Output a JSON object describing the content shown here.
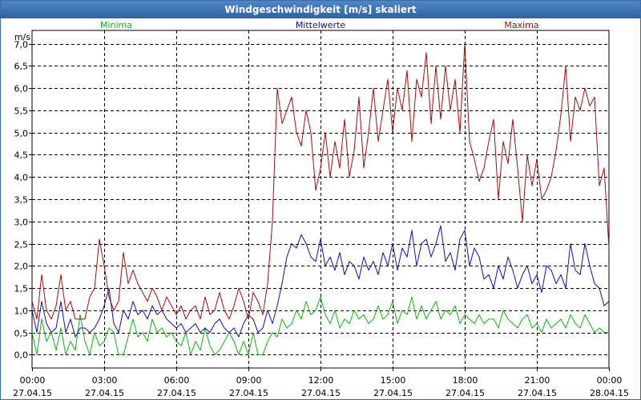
{
  "window": {
    "title": "Windgeschwindigkeit [m/s] skaliert"
  },
  "chart_data": {
    "type": "line",
    "title": "Windgeschwindigkeit [m/s] skaliert",
    "ylabel": "m/s",
    "xlabel": "",
    "ylim": [
      -0.3,
      7.3
    ],
    "xlim": [
      0,
      24
    ],
    "grid": true,
    "y_ticks": [
      "0,0",
      "0,5",
      "1,0",
      "1,5",
      "2,0",
      "2,5",
      "3,0",
      "3,5",
      "4,0",
      "4,5",
      "5,0",
      "5,5",
      "6,0",
      "6,5",
      "7,0"
    ],
    "x_ticks": [
      {
        "time": "00:00",
        "date": "27.04.15"
      },
      {
        "time": "03:00",
        "date": "27.04.15"
      },
      {
        "time": "06:00",
        "date": "27.04.15"
      },
      {
        "time": "09:00",
        "date": "27.04.15"
      },
      {
        "time": "12:00",
        "date": "27.04.15"
      },
      {
        "time": "15:00",
        "date": "27.04.15"
      },
      {
        "time": "18:00",
        "date": "27.04.15"
      },
      {
        "time": "21:00",
        "date": "27.04.15"
      },
      {
        "time": "00:00",
        "date": "28.04.15"
      }
    ],
    "series": [
      {
        "name": "Minima",
        "color": "#18b018",
        "x": [
          0,
          0.2,
          0.4,
          0.6,
          0.8,
          1.0,
          1.2,
          1.4,
          1.6,
          1.8,
          2.0,
          2.2,
          2.4,
          2.6,
          2.8,
          3.0,
          3.2,
          3.4,
          3.6,
          3.8,
          4.0,
          4.2,
          4.4,
          4.6,
          4.8,
          5.0,
          5.2,
          5.4,
          5.6,
          5.8,
          6.0,
          6.2,
          6.4,
          6.6,
          6.8,
          7.0,
          7.2,
          7.4,
          7.6,
          7.8,
          8.0,
          8.2,
          8.4,
          8.6,
          8.8,
          9.0,
          9.2,
          9.4,
          9.6,
          9.8,
          10.0,
          10.2,
          10.4,
          10.6,
          10.8,
          11.0,
          11.2,
          11.4,
          11.6,
          11.8,
          12.0,
          12.2,
          12.4,
          12.6,
          12.8,
          13.0,
          13.2,
          13.4,
          13.6,
          13.8,
          14.0,
          14.2,
          14.4,
          14.6,
          14.8,
          15.0,
          15.2,
          15.4,
          15.6,
          15.8,
          16.0,
          16.2,
          16.4,
          16.6,
          16.8,
          17.0,
          17.2,
          17.4,
          17.6,
          17.8,
          18.0,
          18.2,
          18.4,
          18.6,
          18.8,
          19.0,
          19.2,
          19.4,
          19.6,
          19.8,
          20.0,
          20.2,
          20.4,
          20.6,
          20.8,
          21.0,
          21.2,
          21.4,
          21.6,
          21.8,
          22.0,
          22.2,
          22.4,
          22.6,
          22.8,
          23.0,
          23.2,
          23.4,
          23.6,
          23.8,
          24.0
        ],
        "values": [
          0.5,
          0.0,
          0.8,
          0.3,
          0.5,
          0.1,
          0.6,
          0.0,
          0.3,
          0.1,
          0.9,
          0.3,
          0.0,
          0.5,
          0.2,
          0.3,
          0.6,
          0.5,
          0.0,
          0.0,
          0.4,
          0.8,
          0.4,
          0.5,
          0.3,
          0.8,
          0.5,
          0.6,
          0.4,
          0.5,
          0.3,
          0.2,
          0.5,
          0.0,
          0.3,
          0.1,
          0.6,
          0.2,
          0.0,
          0.1,
          0.3,
          0.5,
          0.3,
          0.0,
          0.3,
          0.0,
          0.5,
          0.0,
          0.0,
          0.3,
          0.5,
          0.4,
          0.8,
          0.6,
          0.7,
          1.0,
          0.8,
          1.2,
          0.9,
          1.0,
          1.3,
          0.9,
          0.7,
          1.0,
          0.6,
          0.8,
          0.7,
          1.0,
          0.8,
          0.9,
          0.7,
          0.8,
          1.1,
          0.8,
          0.9,
          1.2,
          0.7,
          1.0,
          0.9,
          1.3,
          0.8,
          1.1,
          0.8,
          1.0,
          1.2,
          0.8,
          1.0,
          0.9,
          1.1,
          0.7,
          0.9,
          0.8,
          0.7,
          0.9,
          0.7,
          0.8,
          0.8,
          0.6,
          1.0,
          0.8,
          0.7,
          0.6,
          0.8,
          0.9,
          0.6,
          0.7,
          0.5,
          0.8,
          0.6,
          0.7,
          0.8,
          0.6,
          0.9,
          0.7,
          0.6,
          0.9,
          0.7,
          0.5,
          0.6,
          0.5,
          0.5
        ]
      },
      {
        "name": "Mittelwerte",
        "color": "#1010b0",
        "x": [
          0,
          0.2,
          0.4,
          0.6,
          0.8,
          1.0,
          1.2,
          1.4,
          1.6,
          1.8,
          2.0,
          2.2,
          2.4,
          2.6,
          2.8,
          3.0,
          3.2,
          3.4,
          3.6,
          3.8,
          4.0,
          4.2,
          4.4,
          4.6,
          4.8,
          5.0,
          5.2,
          5.4,
          5.6,
          5.8,
          6.0,
          6.2,
          6.4,
          6.6,
          6.8,
          7.0,
          7.2,
          7.4,
          7.6,
          7.8,
          8.0,
          8.2,
          8.4,
          8.6,
          8.8,
          9.0,
          9.2,
          9.4,
          9.6,
          9.8,
          10.0,
          10.2,
          10.4,
          10.6,
          10.8,
          11.0,
          11.2,
          11.4,
          11.6,
          11.8,
          12.0,
          12.2,
          12.4,
          12.6,
          12.8,
          13.0,
          13.2,
          13.4,
          13.6,
          13.8,
          14.0,
          14.2,
          14.4,
          14.6,
          14.8,
          15.0,
          15.2,
          15.4,
          15.6,
          15.8,
          16.0,
          16.2,
          16.4,
          16.6,
          16.8,
          17.0,
          17.2,
          17.4,
          17.6,
          17.8,
          18.0,
          18.2,
          18.4,
          18.6,
          18.8,
          19.0,
          19.2,
          19.4,
          19.6,
          19.8,
          20.0,
          20.2,
          20.4,
          20.6,
          20.8,
          21.0,
          21.2,
          21.4,
          21.6,
          21.8,
          22.0,
          22.2,
          22.4,
          22.6,
          22.8,
          23.0,
          23.2,
          23.4,
          23.6,
          23.8,
          24.0
        ],
        "values": [
          1.0,
          0.5,
          1.2,
          0.7,
          0.5,
          0.6,
          1.2,
          0.5,
          0.8,
          0.4,
          0.6,
          0.6,
          0.5,
          0.6,
          0.8,
          1.1,
          1.5,
          0.7,
          0.5,
          1.0,
          0.8,
          1.2,
          0.9,
          1.0,
          0.8,
          1.1,
          0.9,
          1.0,
          0.8,
          0.7,
          0.6,
          0.7,
          0.5,
          0.6,
          0.7,
          0.5,
          0.6,
          0.5,
          0.7,
          0.8,
          0.6,
          0.5,
          0.6,
          0.4,
          0.7,
          0.9,
          0.8,
          0.5,
          0.6,
          1.0,
          0.7,
          1.1,
          1.6,
          2.2,
          2.5,
          2.4,
          2.7,
          2.5,
          2.2,
          2.1,
          2.6,
          2.0,
          2.2,
          1.9,
          2.3,
          1.8,
          2.1,
          2.0,
          1.7,
          2.2,
          1.9,
          2.1,
          1.8,
          2.3,
          2.0,
          2.5,
          1.9,
          2.4,
          2.2,
          2.8,
          2.0,
          2.5,
          2.6,
          2.2,
          2.5,
          2.9,
          2.1,
          2.3,
          1.9,
          2.6,
          2.8,
          2.0,
          2.4,
          2.2,
          1.7,
          1.8,
          1.5,
          2.0,
          1.7,
          2.2,
          1.9,
          1.5,
          1.8,
          2.0,
          1.6,
          1.8,
          1.4,
          2.0,
          1.9,
          1.6,
          1.8,
          1.5,
          2.5,
          1.9,
          1.8,
          2.5,
          2.0,
          1.6,
          1.5,
          1.1,
          1.2
        ]
      },
      {
        "name": "Maxima",
        "color": "#a01010",
        "x": [
          0,
          0.2,
          0.4,
          0.6,
          0.8,
          1.0,
          1.2,
          1.4,
          1.6,
          1.8,
          2.0,
          2.2,
          2.4,
          2.6,
          2.8,
          3.0,
          3.2,
          3.4,
          3.6,
          3.8,
          4.0,
          4.2,
          4.4,
          4.6,
          4.8,
          5.0,
          5.2,
          5.4,
          5.6,
          5.8,
          6.0,
          6.2,
          6.4,
          6.6,
          6.8,
          7.0,
          7.2,
          7.4,
          7.6,
          7.8,
          8.0,
          8.2,
          8.4,
          8.6,
          8.8,
          9.0,
          9.2,
          9.4,
          9.6,
          9.8,
          10.0,
          10.2,
          10.4,
          10.6,
          10.8,
          11.0,
          11.2,
          11.4,
          11.6,
          11.8,
          12.0,
          12.2,
          12.4,
          12.6,
          12.8,
          13.0,
          13.2,
          13.4,
          13.6,
          13.8,
          14.0,
          14.2,
          14.4,
          14.6,
          14.8,
          15.0,
          15.2,
          15.4,
          15.6,
          15.8,
          16.0,
          16.2,
          16.4,
          16.6,
          16.8,
          17.0,
          17.2,
          17.4,
          17.6,
          17.8,
          18.0,
          18.2,
          18.4,
          18.6,
          18.8,
          19.0,
          19.2,
          19.4,
          19.6,
          19.8,
          20.0,
          20.2,
          20.4,
          20.6,
          20.8,
          21.0,
          21.2,
          21.4,
          21.6,
          21.8,
          22.0,
          22.2,
          22.4,
          22.6,
          22.8,
          23.0,
          23.2,
          23.4,
          23.6,
          23.8,
          24.0
        ],
        "values": [
          1.2,
          0.8,
          1.8,
          1.0,
          0.8,
          1.1,
          1.8,
          1.0,
          1.2,
          0.8,
          0.8,
          0.8,
          1.3,
          1.5,
          2.6,
          2.0,
          1.3,
          1.0,
          1.2,
          2.3,
          1.6,
          1.9,
          1.6,
          1.4,
          1.2,
          1.5,
          1.3,
          1.0,
          1.3,
          1.1,
          0.9,
          1.1,
          0.8,
          1.0,
          1.1,
          0.8,
          1.3,
          0.9,
          1.0,
          1.4,
          1.0,
          0.8,
          1.1,
          1.5,
          1.2,
          0.8,
          1.4,
          1.2,
          0.9,
          1.6,
          3.0,
          6.0,
          5.2,
          5.5,
          5.8,
          5.0,
          4.7,
          5.5,
          5.0,
          3.7,
          4.2,
          5.0,
          4.0,
          4.8,
          4.2,
          5.3,
          4.0,
          4.6,
          5.8,
          4.2,
          5.0,
          6.0,
          4.8,
          5.5,
          6.2,
          5.0,
          6.0,
          5.5,
          6.4,
          4.8,
          6.2,
          5.8,
          6.8,
          5.2,
          6.5,
          5.3,
          6.5,
          5.5,
          6.2,
          5.0,
          7.0,
          4.8,
          4.4,
          3.9,
          4.2,
          4.8,
          5.3,
          3.5,
          4.8,
          4.3,
          5.3,
          4.2,
          3.0,
          4.5,
          3.8,
          4.4,
          3.5,
          3.7,
          4.0,
          4.6,
          5.4,
          6.5,
          4.8,
          5.8,
          5.5,
          6.0,
          5.6,
          5.8,
          3.8,
          4.2,
          2.4
        ]
      }
    ]
  }
}
